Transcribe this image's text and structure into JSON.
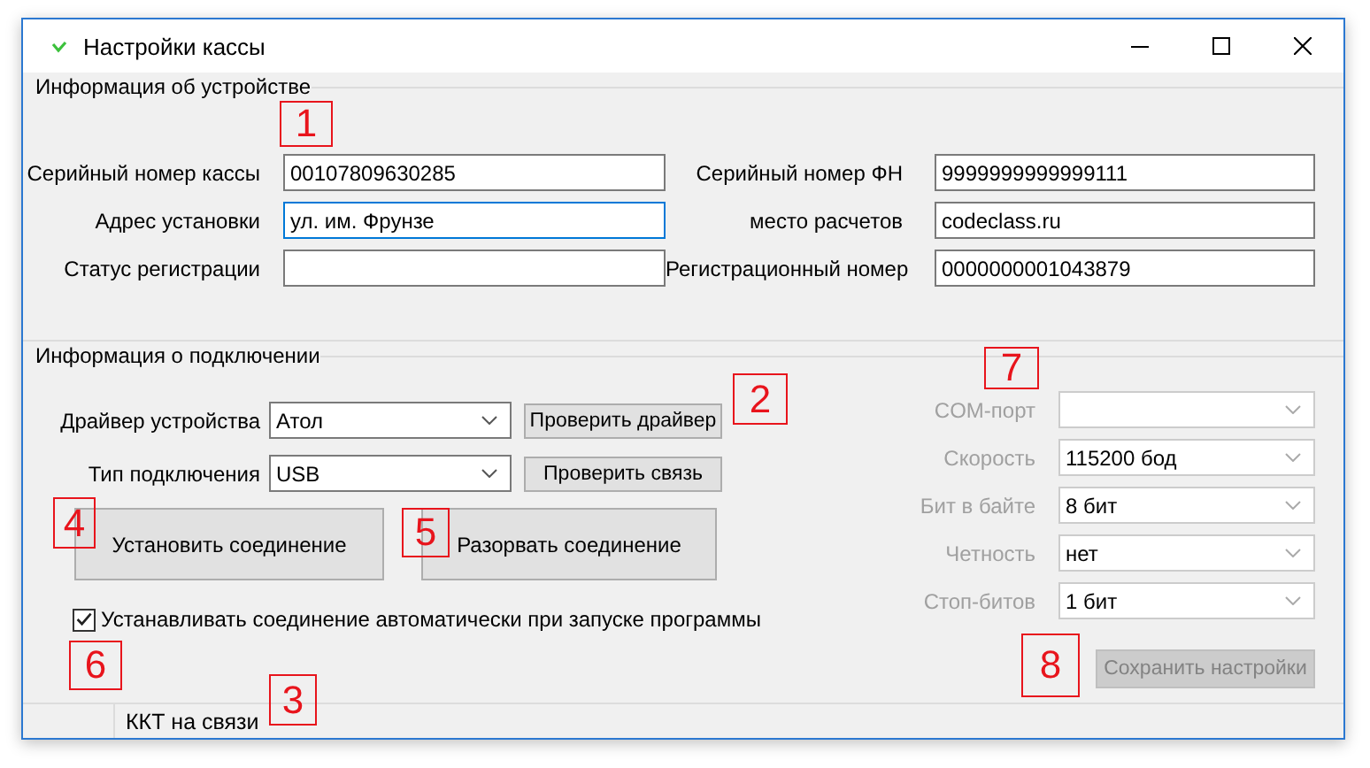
{
  "window": {
    "title": "Настройки кассы"
  },
  "device_info": {
    "title": "Информация об устройстве",
    "fields": [
      {
        "label": "Серийный номер кассы",
        "value": "00107809630285",
        "focused": false
      },
      {
        "label": "Серийный номер ФН",
        "value": "9999999999999111",
        "focused": false
      },
      {
        "label": "Адрес установки",
        "value": "ул. им. Фрунзе",
        "focused": true
      },
      {
        "label": "место расчетов",
        "value": "codeclass.ru",
        "focused": false
      },
      {
        "label": "Статус регистрации",
        "focused": false
      },
      {
        "label": "Регистрационный номер",
        "value": "0000000001043879",
        "focused": false
      }
    ]
  },
  "connection": {
    "title": "Информация о подключении",
    "selects": [
      {
        "label": "Драйвер устройства",
        "value": "Атол",
        "button": "Проверить драйвер"
      },
      {
        "label": "Тип подключения",
        "value": "USB",
        "button": "Проверить связь"
      }
    ],
    "actions": [
      "Установить соединение",
      "Разорвать соединение"
    ],
    "auto_connect": {
      "label": "Устанавливать соединение автоматически при запуске программы",
      "checked": true
    },
    "port_settings": {
      "disabled": true,
      "rows": [
        {
          "label": "COM-порт"
        },
        {
          "label": "Скорость",
          "value": "115200 бод"
        },
        {
          "label": "Бит в байте",
          "value": "8 бит"
        },
        {
          "label": "Четность",
          "value": "нет"
        },
        {
          "label": "Стоп-битов",
          "value": "1 бит"
        }
      ]
    },
    "save_button": {
      "label": "Сохранить настройки",
      "disabled": true
    }
  },
  "status_bar": {
    "text": "ККТ на связи"
  },
  "callouts": [
    "1",
    "2",
    "3",
    "4",
    "5",
    "6",
    "7",
    "8"
  ]
}
